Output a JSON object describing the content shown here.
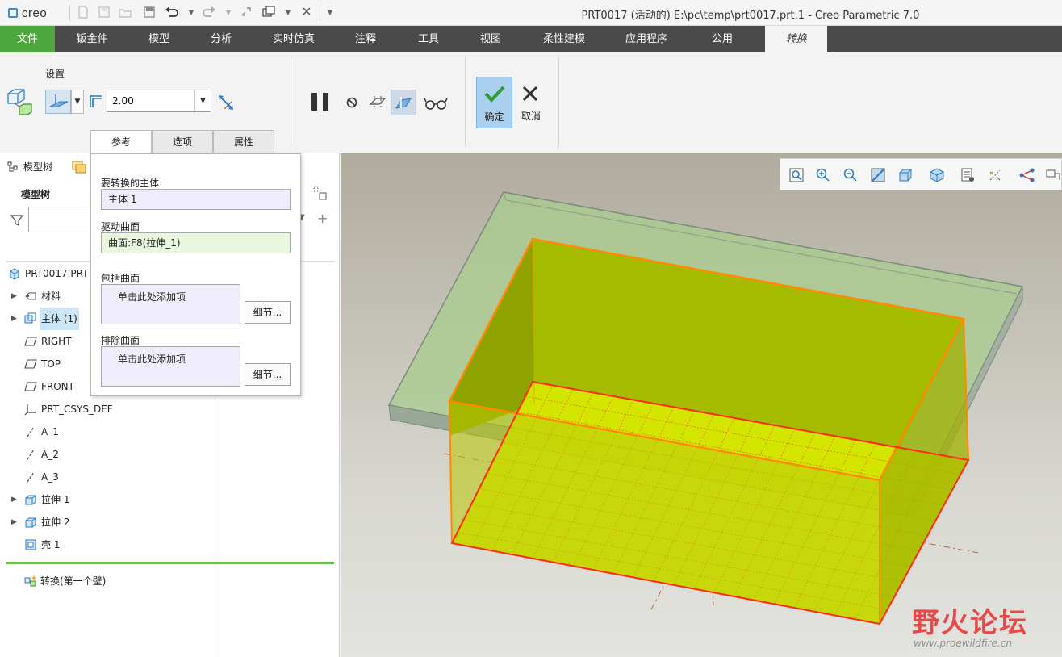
{
  "app": {
    "logo_text": "creo",
    "window_title": "PRT0017 (活动的) E:\\pc\\temp\\prt0017.prt.1 - Creo Parametric 7.0"
  },
  "ribbon_tabs": [
    "文件",
    "钣金件",
    "模型",
    "分析",
    "实时仿真",
    "注释",
    "工具",
    "视图",
    "柔性建模",
    "应用程序",
    "公用",
    "转换"
  ],
  "ribbon": {
    "settings_label": "设置",
    "thickness_value": "2.00",
    "sub_tabs": [
      "参考",
      "选项",
      "属性"
    ],
    "ok_label": "确定",
    "cancel_label": "取消"
  },
  "left_panel": {
    "model_tree_tab": "模型树",
    "tree_title": "模型树",
    "search_value": "",
    "tree": [
      {
        "label": "PRT0017.PRT",
        "icon": "part-icon",
        "expandable": false
      },
      {
        "label": "材料",
        "icon": "material-icon",
        "expandable": true
      },
      {
        "label": "主体 (1)",
        "icon": "body-icon",
        "expandable": true
      },
      {
        "label": "RIGHT",
        "icon": "datum-plane-icon",
        "expandable": false
      },
      {
        "label": "TOP",
        "icon": "datum-plane-icon",
        "expandable": false
      },
      {
        "label": "FRONT",
        "icon": "datum-plane-icon",
        "expandable": false
      },
      {
        "label": "PRT_CSYS_DEF",
        "icon": "csys-icon",
        "expandable": false
      },
      {
        "label": "A_1",
        "icon": "axis-icon",
        "expandable": false
      },
      {
        "label": "A_2",
        "icon": "axis-icon",
        "expandable": false
      },
      {
        "label": "A_3",
        "icon": "axis-icon",
        "expandable": false
      },
      {
        "label": "拉伸 1",
        "icon": "extrude-icon",
        "expandable": true
      },
      {
        "label": "拉伸 2",
        "icon": "extrude-icon",
        "expandable": true
      },
      {
        "label": "壳 1",
        "icon": "shell-icon",
        "expandable": false
      }
    ],
    "insert_row": "转换(第一个壁)"
  },
  "ref_panel": {
    "body_label": "要转换的主体",
    "body_value": "主体 1",
    "drive_label": "驱动曲面",
    "drive_value": "曲面:F8(拉伸_1)",
    "include_label": "包括曲面",
    "include_placeholder": "单击此处添加项",
    "include_details": "细节...",
    "exclude_label": "排除曲面",
    "exclude_placeholder": "单击此处添加项",
    "exclude_details": "细节..."
  },
  "watermark": {
    "title": "野火论坛",
    "url": "www.proewildfire.cn"
  },
  "colors": {
    "file_tab": "#4ca83c",
    "tab_bar": "#4a4a4a",
    "ok_button": "#aad0ef",
    "selection": "#cde6f7",
    "driving_surface_fill": "#e9f7df",
    "collector_fill": "#efecfb",
    "model_yellow": "#b7c800",
    "model_edge": "#ff7f00"
  }
}
